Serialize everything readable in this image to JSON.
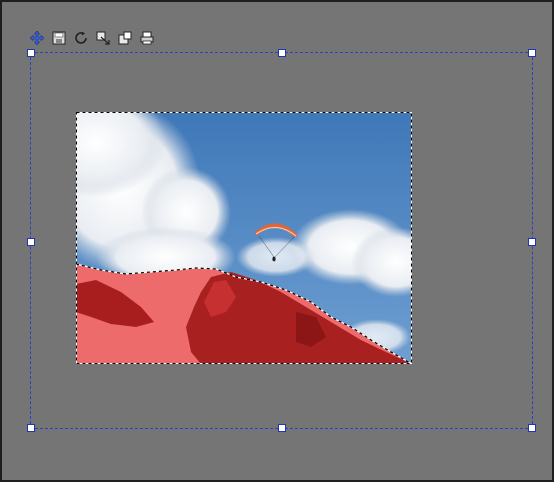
{
  "toolbar": {
    "tools": [
      {
        "icon": "move-icon"
      },
      {
        "icon": "save-icon"
      },
      {
        "icon": "rotate-icon"
      },
      {
        "icon": "flip-icon"
      },
      {
        "icon": "resize-icon"
      },
      {
        "icon": "print-icon"
      }
    ]
  },
  "image": {
    "subject": "paraglider-over-mountain",
    "selection": "mountain-selected",
    "selection_overlay_color": "#ff3b3b",
    "sky_color": "#4a82c0"
  },
  "colors": {
    "canvas_bg": "#757575",
    "handle_border": "#2334b0",
    "selection_border": "#2f3fc4"
  }
}
